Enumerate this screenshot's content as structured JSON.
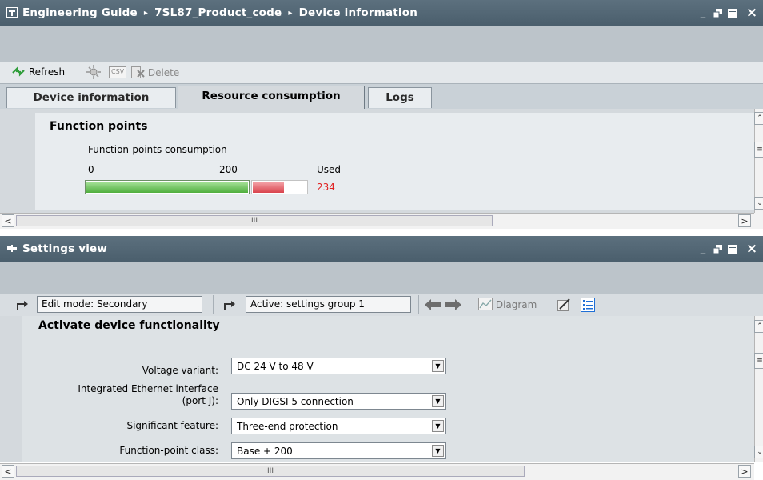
{
  "top_window": {
    "breadcrumb": [
      "Engineering Guide",
      "7SL87_Product_code",
      "Device information"
    ],
    "breadcrumb_sep": "▸",
    "window_controls": [
      "_",
      "▪",
      "■",
      "×"
    ]
  },
  "toolbar": {
    "refresh_label": "Refresh",
    "csv_label": "CSV",
    "delete_label": "Delete"
  },
  "tabs": [
    {
      "label": "Device information",
      "active": false
    },
    {
      "label": "Resource consumption",
      "active": true
    },
    {
      "label": "Logs",
      "active": false
    }
  ],
  "function_points": {
    "heading": "Function points",
    "subheading": "Function-points consumption",
    "scale_start": "0",
    "scale_mid": "200",
    "used_label": "Used",
    "used_value": "234",
    "capacity": 200,
    "used": 234,
    "ok_color": "#5fbf4a",
    "over_color": "#e8636b"
  },
  "settings_window": {
    "title": "Settings view"
  },
  "settings_toolbar": {
    "edit_mode": "Edit mode:  Secondary",
    "active_group": "Active:  settings group 1",
    "diagram_label": "Diagram"
  },
  "device_functionality": {
    "heading": "Activate device functionality",
    "fields": [
      {
        "label": "Voltage variant:",
        "value": "DC 24 V to 48 V"
      },
      {
        "label_line1": "Integrated Ethernet interface",
        "label_line2": "(port J):",
        "value": "Only DIGSI 5 connection"
      },
      {
        "label": "Significant feature:",
        "value": "Three-end protection"
      },
      {
        "label": "Function-point class:",
        "value": "Base + 200"
      }
    ]
  },
  "colors": {
    "titlebar": "#55697a",
    "accent_red": "#e02020",
    "accent_blue": "#1f6fd6"
  }
}
